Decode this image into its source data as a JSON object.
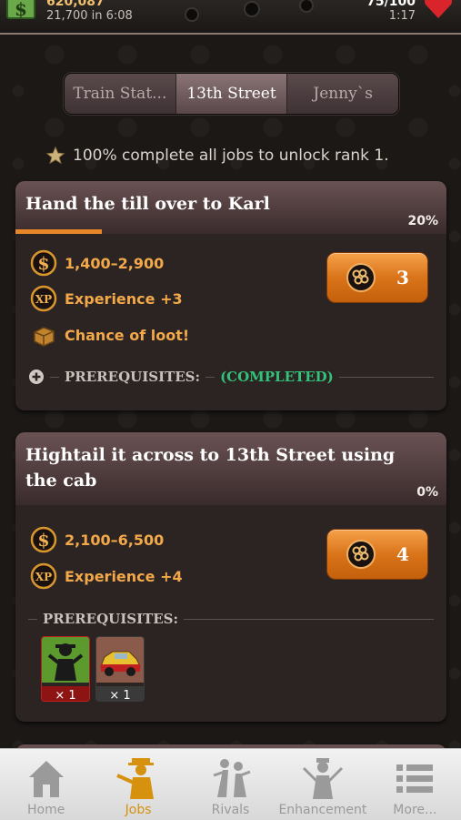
{
  "status": {
    "cash_amount": "620,087",
    "cash_timer": "21,700 in 6:08",
    "health_amount": "75/100",
    "health_timer": "1:17"
  },
  "segments": {
    "items": [
      "Train Stat...",
      "13th Street",
      "Jenny`s"
    ],
    "active_index": 1
  },
  "unlock_text": "100% complete all jobs to unlock rank 1.",
  "jobs": [
    {
      "title": "Hand the till over to Karl",
      "percent_label": "20%",
      "progress": 0.2,
      "cash": "1,400–2,900",
      "experience": "Experience +3",
      "loot": "Chance of loot!",
      "energy_cost": "3",
      "prereq_label": "PREREQUISITES:",
      "prereq_status": "(COMPLETED)"
    },
    {
      "title": "Hightail it across to 13th Street using the cab",
      "percent_label": "0%",
      "progress": 0,
      "cash": "2,100–6,500",
      "experience": "Experience +4",
      "energy_cost": "4",
      "prereq_label": "PREREQUISITES:",
      "items": [
        {
          "name": "gunman-item",
          "count": "× 1"
        },
        {
          "name": "cab-item",
          "count": "× 1"
        }
      ]
    }
  ],
  "tabbar": {
    "items": [
      "Home",
      "Jobs",
      "Rivals",
      "Enhancement",
      "More..."
    ],
    "active": "Jobs"
  },
  "colors": {
    "accent_orange": "#e8862a",
    "reward_text": "#f3a84a",
    "completed_green": "#33c27a",
    "tab_active": "#d6920e"
  }
}
